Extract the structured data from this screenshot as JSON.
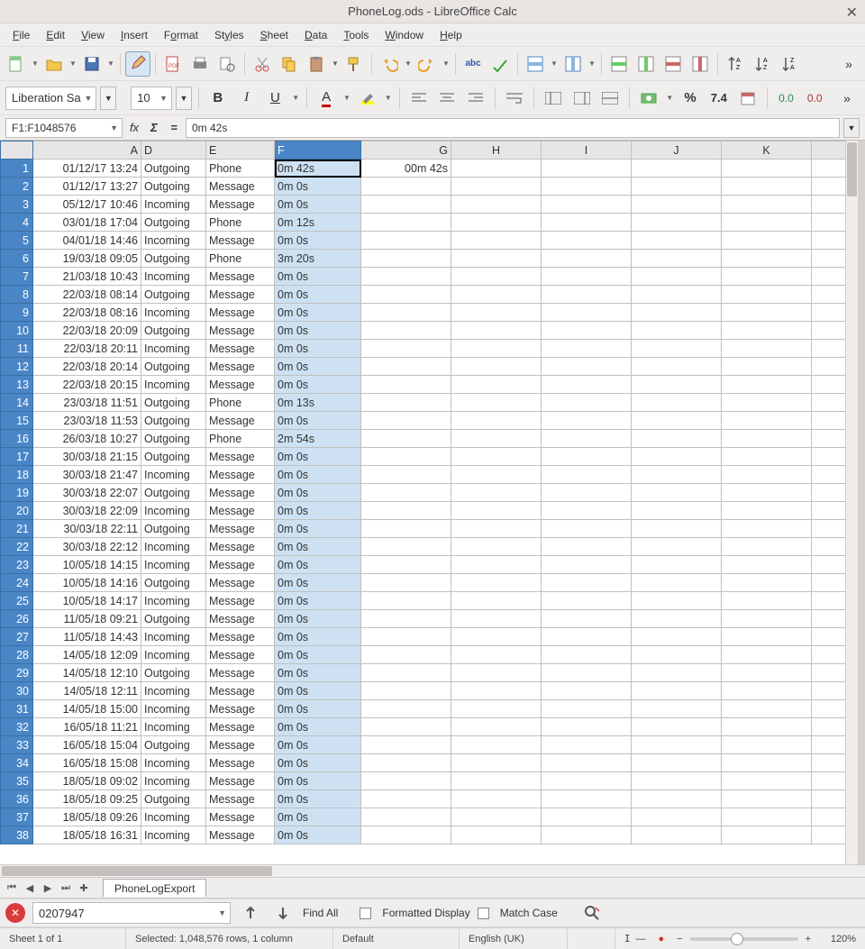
{
  "window": {
    "title": "PhoneLog.ods - LibreOffice Calc"
  },
  "menubar": [
    "File",
    "Edit",
    "View",
    "Insert",
    "Format",
    "Styles",
    "Sheet",
    "Data",
    "Tools",
    "Window",
    "Help"
  ],
  "font": {
    "name": "Liberation Sa",
    "size": "10"
  },
  "name_box": "F1:F1048576",
  "formula_input": "0m 42s",
  "column_headers": [
    "A",
    "D",
    "E",
    "F",
    "G",
    "H",
    "I",
    "J",
    "K",
    ""
  ],
  "selected_column_index": 3,
  "rows": [
    {
      "n": 1,
      "A": "01/12/17 13:24",
      "D": "Outgoing",
      "E": "Phone",
      "F": "0m 42s",
      "G": "00m 42s"
    },
    {
      "n": 2,
      "A": "01/12/17 13:27",
      "D": "Outgoing",
      "E": "Message",
      "F": "0m 0s",
      "G": ""
    },
    {
      "n": 3,
      "A": "05/12/17 10:46",
      "D": "Incoming",
      "E": "Message",
      "F": "0m 0s",
      "G": ""
    },
    {
      "n": 4,
      "A": "03/01/18 17:04",
      "D": "Outgoing",
      "E": "Phone",
      "F": "0m 12s",
      "G": ""
    },
    {
      "n": 5,
      "A": "04/01/18 14:46",
      "D": "Incoming",
      "E": "Message",
      "F": "0m 0s",
      "G": ""
    },
    {
      "n": 6,
      "A": "19/03/18 09:05",
      "D": "Outgoing",
      "E": "Phone",
      "F": "3m 20s",
      "G": ""
    },
    {
      "n": 7,
      "A": "21/03/18 10:43",
      "D": "Incoming",
      "E": "Message",
      "F": "0m 0s",
      "G": ""
    },
    {
      "n": 8,
      "A": "22/03/18 08:14",
      "D": "Outgoing",
      "E": "Message",
      "F": "0m 0s",
      "G": ""
    },
    {
      "n": 9,
      "A": "22/03/18 08:16",
      "D": "Incoming",
      "E": "Message",
      "F": "0m 0s",
      "G": ""
    },
    {
      "n": 10,
      "A": "22/03/18 20:09",
      "D": "Outgoing",
      "E": "Message",
      "F": "0m 0s",
      "G": ""
    },
    {
      "n": 11,
      "A": "22/03/18 20:11",
      "D": "Incoming",
      "E": "Message",
      "F": "0m 0s",
      "G": ""
    },
    {
      "n": 12,
      "A": "22/03/18 20:14",
      "D": "Outgoing",
      "E": "Message",
      "F": "0m 0s",
      "G": ""
    },
    {
      "n": 13,
      "A": "22/03/18 20:15",
      "D": "Incoming",
      "E": "Message",
      "F": "0m 0s",
      "G": ""
    },
    {
      "n": 14,
      "A": "23/03/18 11:51",
      "D": "Outgoing",
      "E": "Phone",
      "F": "0m 13s",
      "G": ""
    },
    {
      "n": 15,
      "A": "23/03/18 11:53",
      "D": "Outgoing",
      "E": "Message",
      "F": "0m 0s",
      "G": ""
    },
    {
      "n": 16,
      "A": "26/03/18 10:27",
      "D": "Outgoing",
      "E": "Phone",
      "F": "2m 54s",
      "G": ""
    },
    {
      "n": 17,
      "A": "30/03/18 21:15",
      "D": "Outgoing",
      "E": "Message",
      "F": "0m 0s",
      "G": ""
    },
    {
      "n": 18,
      "A": "30/03/18 21:47",
      "D": "Incoming",
      "E": "Message",
      "F": "0m 0s",
      "G": ""
    },
    {
      "n": 19,
      "A": "30/03/18 22:07",
      "D": "Outgoing",
      "E": "Message",
      "F": "0m 0s",
      "G": ""
    },
    {
      "n": 20,
      "A": "30/03/18 22:09",
      "D": "Incoming",
      "E": "Message",
      "F": "0m 0s",
      "G": ""
    },
    {
      "n": 21,
      "A": "30/03/18 22:11",
      "D": "Outgoing",
      "E": "Message",
      "F": "0m 0s",
      "G": ""
    },
    {
      "n": 22,
      "A": "30/03/18 22:12",
      "D": "Incoming",
      "E": "Message",
      "F": "0m 0s",
      "G": ""
    },
    {
      "n": 23,
      "A": "10/05/18 14:15",
      "D": "Incoming",
      "E": "Message",
      "F": "0m 0s",
      "G": ""
    },
    {
      "n": 24,
      "A": "10/05/18 14:16",
      "D": "Outgoing",
      "E": "Message",
      "F": "0m 0s",
      "G": ""
    },
    {
      "n": 25,
      "A": "10/05/18 14:17",
      "D": "Incoming",
      "E": "Message",
      "F": "0m 0s",
      "G": ""
    },
    {
      "n": 26,
      "A": "11/05/18 09:21",
      "D": "Outgoing",
      "E": "Message",
      "F": "0m 0s",
      "G": ""
    },
    {
      "n": 27,
      "A": "11/05/18 14:43",
      "D": "Incoming",
      "E": "Message",
      "F": "0m 0s",
      "G": ""
    },
    {
      "n": 28,
      "A": "14/05/18 12:09",
      "D": "Incoming",
      "E": "Message",
      "F": "0m 0s",
      "G": ""
    },
    {
      "n": 29,
      "A": "14/05/18 12:10",
      "D": "Outgoing",
      "E": "Message",
      "F": "0m 0s",
      "G": ""
    },
    {
      "n": 30,
      "A": "14/05/18 12:11",
      "D": "Incoming",
      "E": "Message",
      "F": "0m 0s",
      "G": ""
    },
    {
      "n": 31,
      "A": "14/05/18 15:00",
      "D": "Incoming",
      "E": "Message",
      "F": "0m 0s",
      "G": ""
    },
    {
      "n": 32,
      "A": "16/05/18 11:21",
      "D": "Incoming",
      "E": "Message",
      "F": "0m 0s",
      "G": ""
    },
    {
      "n": 33,
      "A": "16/05/18 15:04",
      "D": "Outgoing",
      "E": "Message",
      "F": "0m 0s",
      "G": ""
    },
    {
      "n": 34,
      "A": "16/05/18 15:08",
      "D": "Incoming",
      "E": "Message",
      "F": "0m 0s",
      "G": ""
    },
    {
      "n": 35,
      "A": "18/05/18 09:02",
      "D": "Incoming",
      "E": "Message",
      "F": "0m 0s",
      "G": ""
    },
    {
      "n": 36,
      "A": "18/05/18 09:25",
      "D": "Outgoing",
      "E": "Message",
      "F": "0m 0s",
      "G": ""
    },
    {
      "n": 37,
      "A": "18/05/18 09:26",
      "D": "Incoming",
      "E": "Message",
      "F": "0m 0s",
      "G": ""
    },
    {
      "n": 38,
      "A": "18/05/18 16:31",
      "D": "Incoming",
      "E": "Message",
      "F": "0m 0s",
      "G": ""
    }
  ],
  "sheet_tab": "PhoneLogExport",
  "find": {
    "term": "0207947",
    "find_all": "Find All",
    "formatted": "Formatted Display",
    "match_case": "Match Case"
  },
  "status": {
    "sheet": "Sheet 1 of 1",
    "selection": "Selected: 1,048,576 rows, 1 column",
    "style": "Default",
    "language": "English (UK)",
    "zoom": "120%"
  }
}
